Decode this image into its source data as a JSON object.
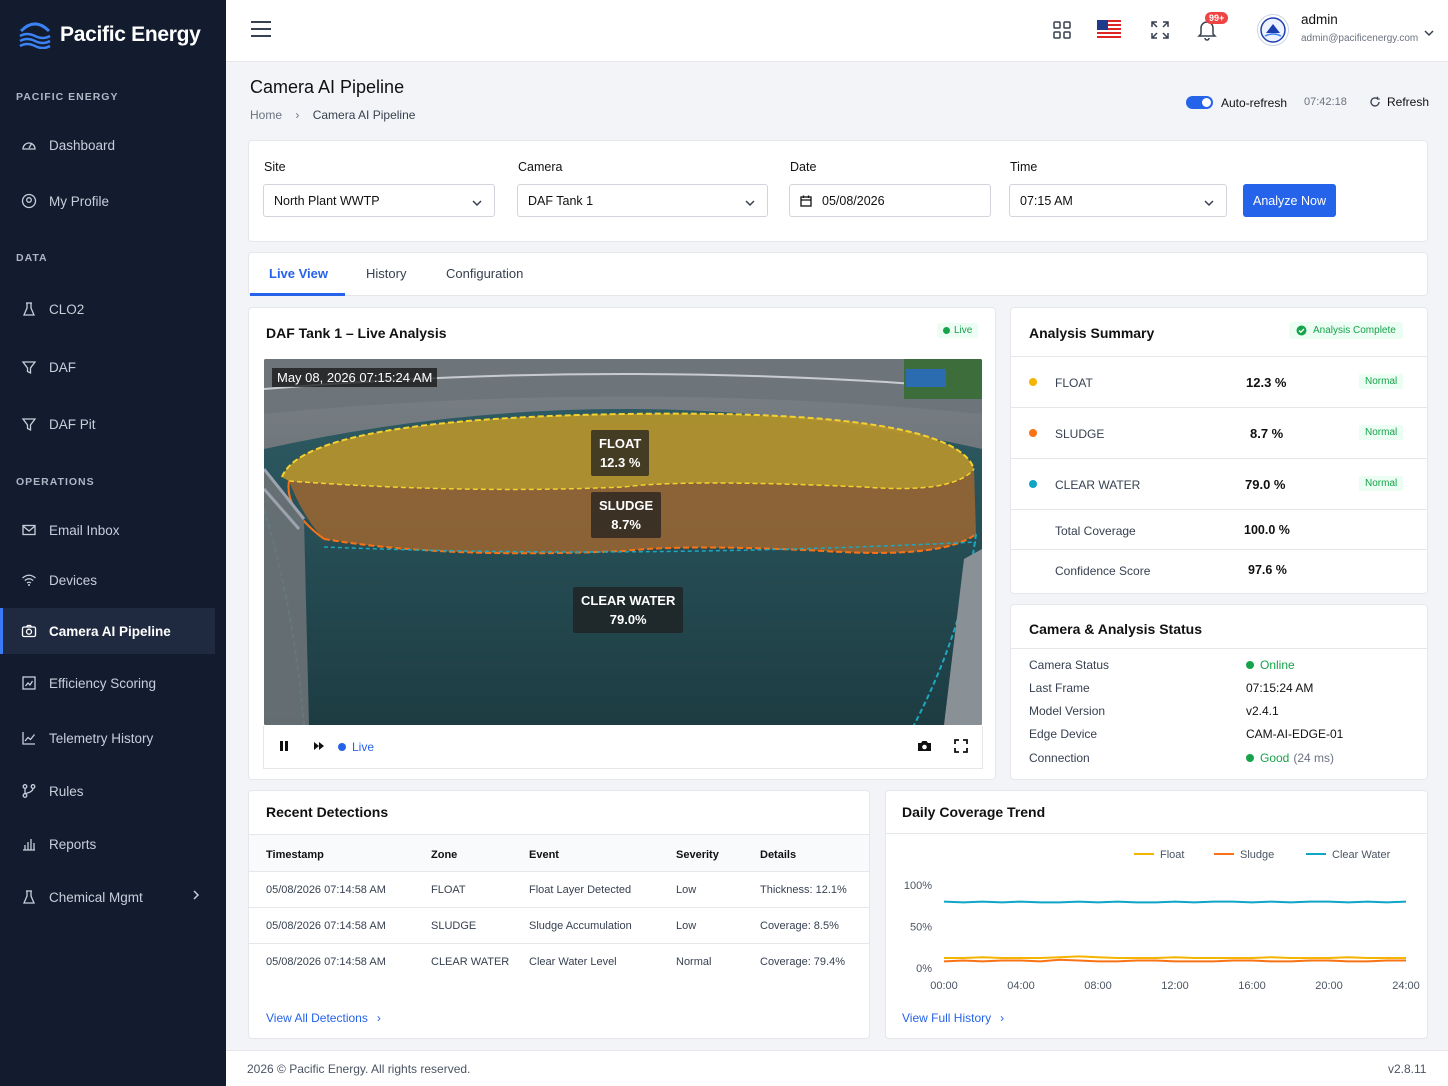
{
  "brand": {
    "name": "Pacific Energy"
  },
  "sidebar": {
    "sections": [
      "PACIFIC ENERGY",
      "DATA",
      "OPERATIONS"
    ],
    "items": [
      {
        "label": "Dashboard",
        "icon": "gauge-icon"
      },
      {
        "label": "My Profile",
        "icon": "user-circle-icon"
      },
      {
        "label": "CLO2",
        "icon": "flask-icon"
      },
      {
        "label": "DAF",
        "icon": "filter-icon"
      },
      {
        "label": "DAF Pit",
        "icon": "filter-icon"
      },
      {
        "label": "Email Inbox",
        "icon": "mail-icon"
      },
      {
        "label": "Devices",
        "icon": "wifi-icon"
      },
      {
        "label": "Camera AI Pipeline",
        "icon": "camera-icon"
      },
      {
        "label": "Efficiency Scoring",
        "icon": "score-icon"
      },
      {
        "label": "Telemetry History",
        "icon": "line-chart-icon"
      },
      {
        "label": "Rules",
        "icon": "branch-icon"
      },
      {
        "label": "Reports",
        "icon": "bar-chart-icon"
      },
      {
        "label": "Chemical Mgmt",
        "icon": "flask-icon"
      }
    ],
    "active": "Camera AI Pipeline"
  },
  "topbar": {
    "notifications": "99+",
    "user_name": "admin",
    "user_email": "admin@pacificenergy.com"
  },
  "page": {
    "title": "Camera AI Pipeline",
    "breadcrumb": [
      "Home",
      "Camera AI Pipeline"
    ],
    "auto_refresh_label": "Auto-refresh",
    "time": "07:42:18",
    "refresh_label": "Refresh"
  },
  "filters": {
    "site_label": "Site",
    "site_value": "North Plant WWTP",
    "camera_label": "Camera",
    "camera_value": "DAF Tank 1",
    "date_label": "Date",
    "date_value": "05/08/2026",
    "time_label": "Time",
    "time_value": "07:15 AM",
    "analyze_label": "Analyze Now"
  },
  "tabs": [
    "Live View",
    "History",
    "Configuration"
  ],
  "live": {
    "title": "DAF Tank 1 – Live Analysis",
    "badge": "Live",
    "timestamp": "May 08, 2026 07:15:24 AM",
    "zones": [
      {
        "name": "FLOAT",
        "value": "12.3 %"
      },
      {
        "name": "SLUDGE",
        "value": "8.7%"
      },
      {
        "name": "CLEAR WATER",
        "value": "79.0%"
      }
    ],
    "live_label": "Live"
  },
  "summary": {
    "title": "Analysis Summary",
    "status": "Analysis Complete",
    "rows": [
      {
        "label": "FLOAT",
        "value": "12.3 %",
        "status": "Normal",
        "color": "#f5b400"
      },
      {
        "label": "SLUDGE",
        "value": "8.7 %",
        "status": "Normal",
        "color": "#f97316"
      },
      {
        "label": "CLEAR WATER",
        "value": "79.0 %",
        "status": "Normal",
        "color": "#0ea5c6"
      }
    ],
    "total_label": "Total Coverage",
    "total_value": "100.0 %",
    "confidence_label": "Confidence Score",
    "confidence_value": "97.6 %"
  },
  "status": {
    "title": "Camera & Analysis Status",
    "rows": [
      {
        "label": "Camera Status",
        "value": "Online"
      },
      {
        "label": "Last Frame",
        "value": "07:15:24 AM"
      },
      {
        "label": "Model Version",
        "value": "v2.4.1"
      },
      {
        "label": "Edge Device",
        "value": "CAM-AI-EDGE-01"
      },
      {
        "label": "Connection",
        "value": "Good",
        "extra": "(24 ms)"
      }
    ]
  },
  "detections": {
    "title": "Recent Detections",
    "headers": [
      "Timestamp",
      "Zone",
      "Event",
      "Severity",
      "Details"
    ],
    "rows": [
      [
        "05/08/2026 07:14:58 AM",
        "FLOAT",
        "Float Layer Detected",
        "Low",
        "Thickness: 12.1%"
      ],
      [
        "05/08/2026 07:14:58 AM",
        "SLUDGE",
        "Sludge Accumulation",
        "Low",
        "Coverage: 8.5%"
      ],
      [
        "05/08/2026 07:14:58 AM",
        "CLEAR WATER",
        "Clear Water Level",
        "Normal",
        "Coverage: 79.4%"
      ]
    ],
    "link": "View All Detections"
  },
  "trend": {
    "title": "Daily Coverage Trend",
    "link": "View Full History"
  },
  "chart_data": {
    "type": "line",
    "x": [
      "00:00",
      "01:00",
      "02:00",
      "03:00",
      "04:00",
      "05:00",
      "06:00",
      "07:00",
      "08:00",
      "09:00",
      "10:00",
      "11:00",
      "12:00",
      "13:00",
      "14:00",
      "15:00",
      "16:00",
      "17:00",
      "18:00",
      "19:00",
      "20:00",
      "21:00",
      "22:00",
      "23:00",
      "24:00"
    ],
    "x_ticks": [
      "00:00",
      "04:00",
      "08:00",
      "12:00",
      "16:00",
      "20:00",
      "24:00"
    ],
    "y_ticks": [
      "100%",
      "50%",
      "0%"
    ],
    "ylim": [
      0,
      100
    ],
    "series": [
      {
        "name": "Float",
        "color": "#f5b400",
        "values": [
          12,
          12,
          13,
          12,
          12,
          12,
          13,
          14,
          13,
          12,
          12,
          12,
          13,
          12,
          12,
          12,
          12,
          13,
          12,
          12,
          12,
          13,
          12,
          12,
          12
        ]
      },
      {
        "name": "Sludge",
        "color": "#f97316",
        "values": [
          8,
          9,
          8,
          9,
          9,
          8,
          10,
          9,
          8,
          8,
          9,
          9,
          8,
          8,
          8,
          9,
          9,
          8,
          8,
          9,
          9,
          8,
          8,
          9,
          9
        ]
      },
      {
        "name": "Clear Water",
        "color": "#0ea5c6",
        "values": [
          80,
          79,
          80,
          79,
          80,
          79,
          79,
          80,
          79,
          80,
          79,
          79,
          80,
          79,
          80,
          80,
          79,
          80,
          79,
          80,
          80,
          79,
          80,
          79,
          80
        ]
      }
    ]
  },
  "footer": {
    "copyright": "2026 © Pacific Energy. All rights reserved.",
    "version": "v2.8.11"
  }
}
